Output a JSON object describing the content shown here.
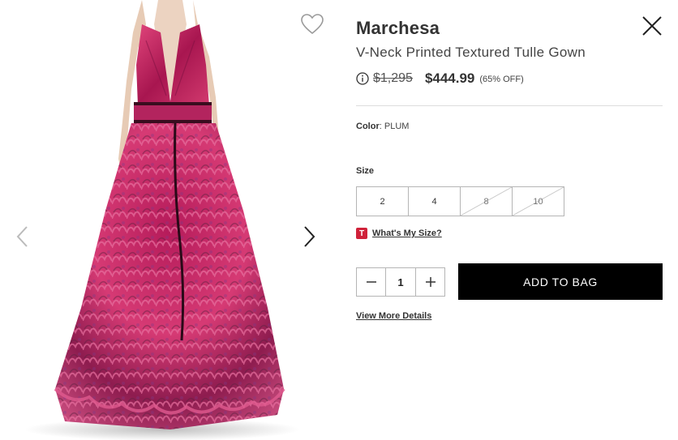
{
  "product": {
    "brand": "Marchesa",
    "title": "V-Neck Printed Textured Tulle Gown",
    "original_price": "$1,295",
    "sale_price": "$444.99",
    "discount": "(65% OFF)"
  },
  "color": {
    "label": "Color",
    "separator": ": ",
    "value": "PLUM"
  },
  "sizes": {
    "label": "Size",
    "options": [
      {
        "label": "2",
        "available": true
      },
      {
        "label": "4",
        "available": true
      },
      {
        "label": "8",
        "available": false
      },
      {
        "label": "10",
        "available": false
      }
    ]
  },
  "size_guide": {
    "badge": "T",
    "label": "What's My Size?"
  },
  "quantity": {
    "value": "1"
  },
  "actions": {
    "add_to_bag": "ADD TO BAG",
    "view_more": "View More Details"
  },
  "icons": {
    "wishlist": "heart-outline-icon",
    "close": "close-x-icon",
    "prev": "chevron-left-icon",
    "next": "chevron-right-icon",
    "info": "info-circle-icon",
    "minus": "minus-icon",
    "plus": "plus-icon"
  },
  "colors": {
    "accent_badge": "#d0223a",
    "button_bg": "#000000",
    "gown_primary": "#c2185b",
    "gown_secondary": "#6a1b4d",
    "waistband": "#3a0d1f"
  }
}
